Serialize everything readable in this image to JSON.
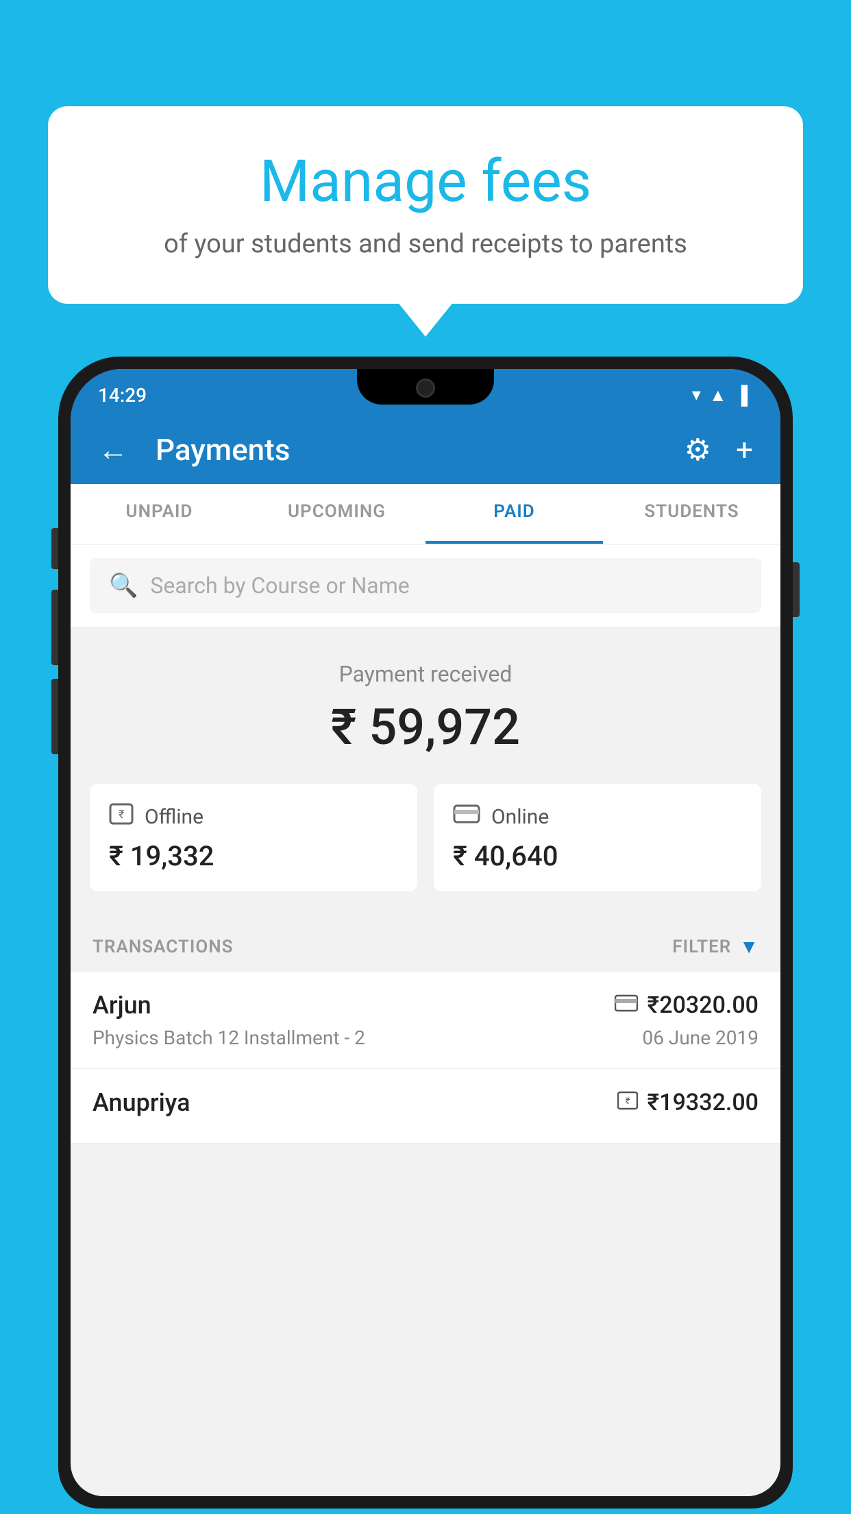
{
  "background_color": "#1BB8E8",
  "bubble": {
    "title": "Manage fees",
    "subtitle": "of your students and send receipts to parents"
  },
  "status_bar": {
    "time": "14:29",
    "icons": [
      "wifi",
      "signal",
      "battery"
    ]
  },
  "app_bar": {
    "title": "Payments",
    "back_label": "←",
    "gear_label": "⚙",
    "plus_label": "+"
  },
  "tabs": [
    {
      "label": "UNPAID",
      "active": false
    },
    {
      "label": "UPCOMING",
      "active": false
    },
    {
      "label": "PAID",
      "active": true
    },
    {
      "label": "STUDENTS",
      "active": false
    }
  ],
  "search": {
    "placeholder": "Search by Course or Name"
  },
  "payment_received": {
    "label": "Payment received",
    "amount": "₹ 59,972",
    "offline_label": "Offline",
    "offline_amount": "₹ 19,332",
    "online_label": "Online",
    "online_amount": "₹ 40,640"
  },
  "transactions": {
    "header": "TRANSACTIONS",
    "filter_label": "FILTER",
    "items": [
      {
        "name": "Arjun",
        "amount": "₹20320.00",
        "payment_type": "card",
        "description": "Physics Batch 12 Installment - 2",
        "date": "06 June 2019"
      },
      {
        "name": "Anupriya",
        "amount": "₹19332.00",
        "payment_type": "offline",
        "description": "",
        "date": ""
      }
    ]
  }
}
